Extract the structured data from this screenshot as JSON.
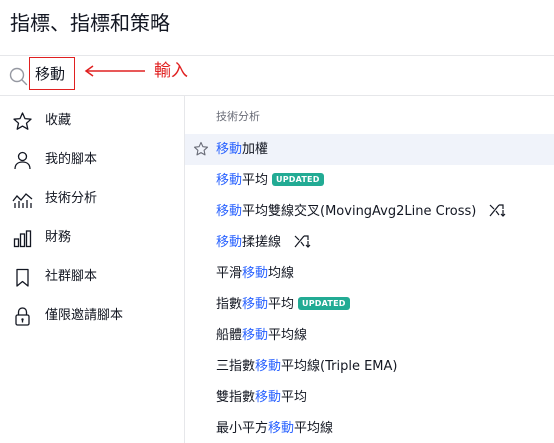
{
  "header": {
    "title": "指標、指標和策略"
  },
  "search": {
    "value": "移動"
  },
  "annotation": {
    "label": "輸入",
    "color": "#e02020"
  },
  "sidebar": {
    "items": [
      {
        "label": "收藏",
        "icon": "star-outline-icon"
      },
      {
        "label": "我的腳本",
        "icon": "user-icon"
      },
      {
        "label": "技術分析",
        "icon": "technical-analysis-icon"
      },
      {
        "label": "財務",
        "icon": "bar-chart-icon"
      },
      {
        "label": "社群腳本",
        "icon": "bookmark-icon"
      },
      {
        "label": "僅限邀請腳本",
        "icon": "lock-icon"
      }
    ]
  },
  "content": {
    "section_heading": "技術分析",
    "accent_color": "#2962ff",
    "badge_color": "#22ab94",
    "results": [
      {
        "prefix": "",
        "match": "移動",
        "suffix": "加權",
        "badge": "",
        "selected": true
      },
      {
        "prefix": "",
        "match": "移動",
        "suffix": "平均",
        "badge": "UPDATED"
      },
      {
        "prefix": "",
        "match": "移動",
        "suffix": "平均雙線交叉(MovingAvg2Line Cross)",
        "badge": "",
        "icon": "strategy-icon"
      },
      {
        "prefix": "",
        "match": "移動",
        "suffix": "揉搓線",
        "badge": "",
        "icon": "strategy-icon"
      },
      {
        "prefix": "平滑",
        "match": "移動",
        "suffix": "均線",
        "badge": ""
      },
      {
        "prefix": "指數",
        "match": "移動",
        "suffix": "平均",
        "badge": "UPDATED"
      },
      {
        "prefix": "船體",
        "match": "移動",
        "suffix": "平均線",
        "badge": ""
      },
      {
        "prefix": "三指數",
        "match": "移動",
        "suffix": "平均線(Triple EMA)",
        "badge": ""
      },
      {
        "prefix": "雙指數",
        "match": "移動",
        "suffix": "平均",
        "badge": ""
      },
      {
        "prefix": "最小平方",
        "match": "移動",
        "suffix": "平均線",
        "badge": ""
      }
    ]
  }
}
